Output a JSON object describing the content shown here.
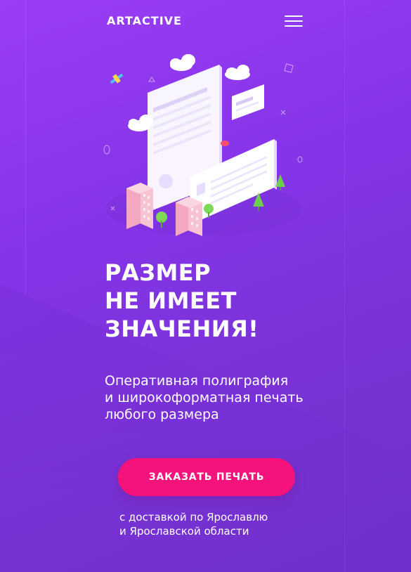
{
  "header": {
    "logo": "ARTACTIVE",
    "menu_icon": "hamburger-menu-icon"
  },
  "hero": {
    "illustration": "isometric-print-documents-city-illustration",
    "headline_lines": [
      "РАЗМЕР",
      "НЕ ИМЕЕТ",
      "ЗНАЧЕНИЯ!"
    ],
    "subtitle_lines": [
      "Оперативная полиграфия",
      "и широкоформатная печать",
      "любого размера"
    ],
    "cta_label": "ЗАКАЗАТЬ ПЕЧАТЬ",
    "delivery_lines": [
      "с доставкой по Ярославлю",
      "и Ярославской области"
    ]
  },
  "colors": {
    "background_start": "#9a3df5",
    "background_end": "#6f2fca",
    "cta_background": "#f5127a",
    "text": "#ffffff"
  }
}
